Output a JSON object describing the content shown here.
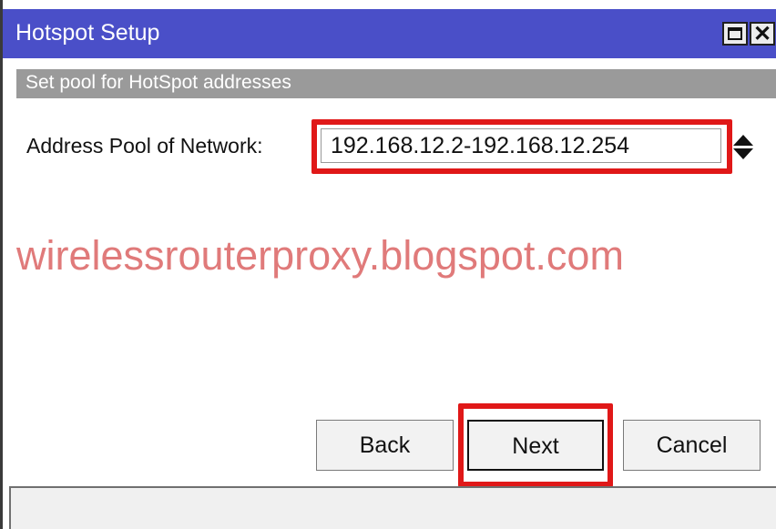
{
  "window": {
    "title": "Hotspot Setup"
  },
  "titlebar": {
    "maximize_icon": "maximize-icon",
    "close_icon": "close-icon",
    "close_glyph": "✕"
  },
  "step": {
    "description": "Set pool for HotSpot addresses"
  },
  "form": {
    "pool_label": "Address Pool of Network:",
    "pool_value": "192.168.12.2-192.168.12.254"
  },
  "watermark": "wirelessrouterproxy.blogspot.com",
  "buttons": {
    "back": "Back",
    "next": "Next",
    "cancel": "Cancel"
  },
  "colors": {
    "titlebar": "#4a4fc8",
    "highlight": "#e01818",
    "watermark": "#e07a7a"
  }
}
